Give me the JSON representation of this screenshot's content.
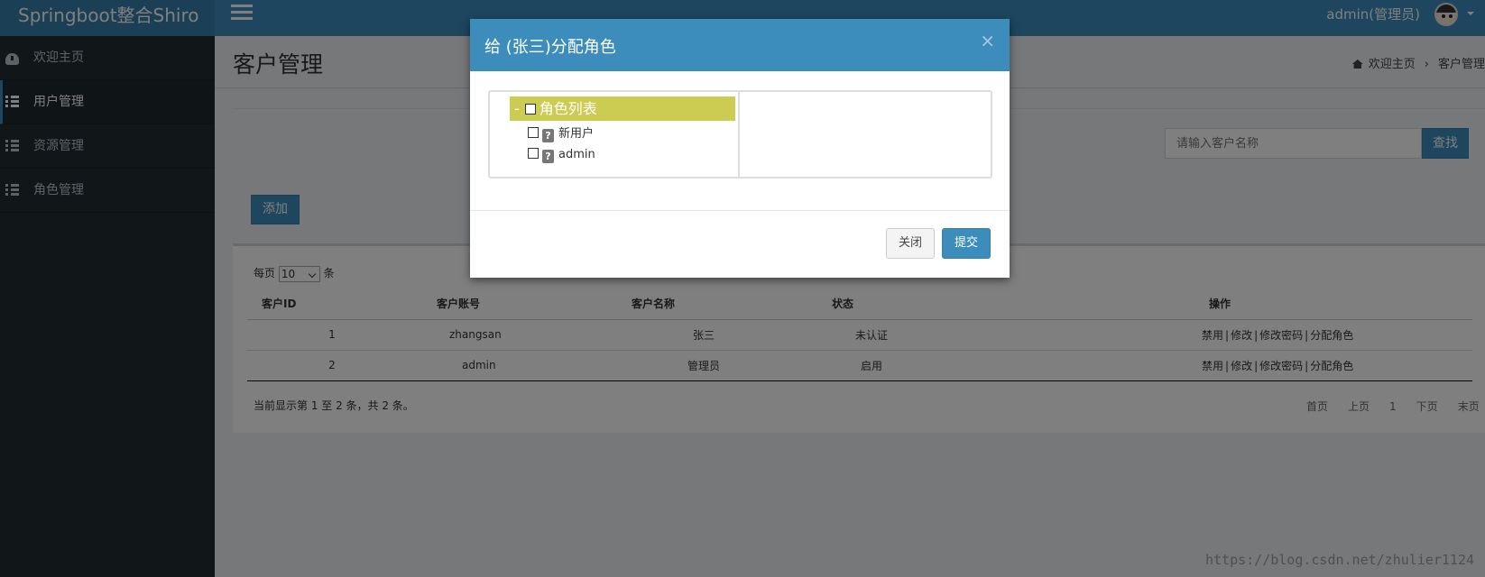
{
  "app": {
    "brand": "Springboot整合Shiro",
    "user": "admin(管理员)"
  },
  "sidebar": {
    "items": [
      {
        "label": "欢迎主页",
        "icon": "dashboard-icon"
      },
      {
        "label": "用户管理",
        "icon": "list-icon"
      },
      {
        "label": "资源管理",
        "icon": "list-icon"
      },
      {
        "label": "角色管理",
        "icon": "list-icon"
      }
    ]
  },
  "header": {
    "title": "客户管理",
    "breadcrumb": [
      "欢迎主页",
      "客户管理"
    ]
  },
  "search": {
    "placeholder": "请输入客户名称",
    "button": "查找"
  },
  "toolbar": {
    "add_label": "添加"
  },
  "table": {
    "length_prefix": "每页",
    "length_value": "10",
    "length_suffix": "条",
    "columns": [
      "客户ID",
      "客户账号",
      "客户名称",
      "状态",
      "操作"
    ],
    "rows": [
      {
        "id": "1",
        "account": "zhangsan",
        "name": "张三",
        "status": "未认证",
        "ops": [
          "禁用",
          "修改",
          "修改密码",
          "分配角色"
        ]
      },
      {
        "id": "2",
        "account": "admin",
        "name": "管理员",
        "status": "启用",
        "ops": [
          "禁用",
          "修改",
          "修改密码",
          "分配角色"
        ]
      }
    ],
    "info": "当前显示第 1 至 2 条，共 2 条。",
    "pager": [
      "首页",
      "上页",
      "1",
      "下页",
      "末页"
    ]
  },
  "modal": {
    "title": "给 (张三)分配角色",
    "close_symbol": "×",
    "tree": {
      "root_toggle": "-",
      "root_label": "角色列表",
      "children": [
        {
          "label": "新用户",
          "icon": "?"
        },
        {
          "label": "admin",
          "icon": "?"
        }
      ]
    },
    "buttons": {
      "close": "关闭",
      "submit": "提交"
    }
  },
  "watermark": "https://blog.csdn.net/zhulier1124",
  "colors": {
    "primary": "#3c8dbc",
    "sidebar_bg": "#222d32",
    "tree_selected": "#cccc52"
  }
}
